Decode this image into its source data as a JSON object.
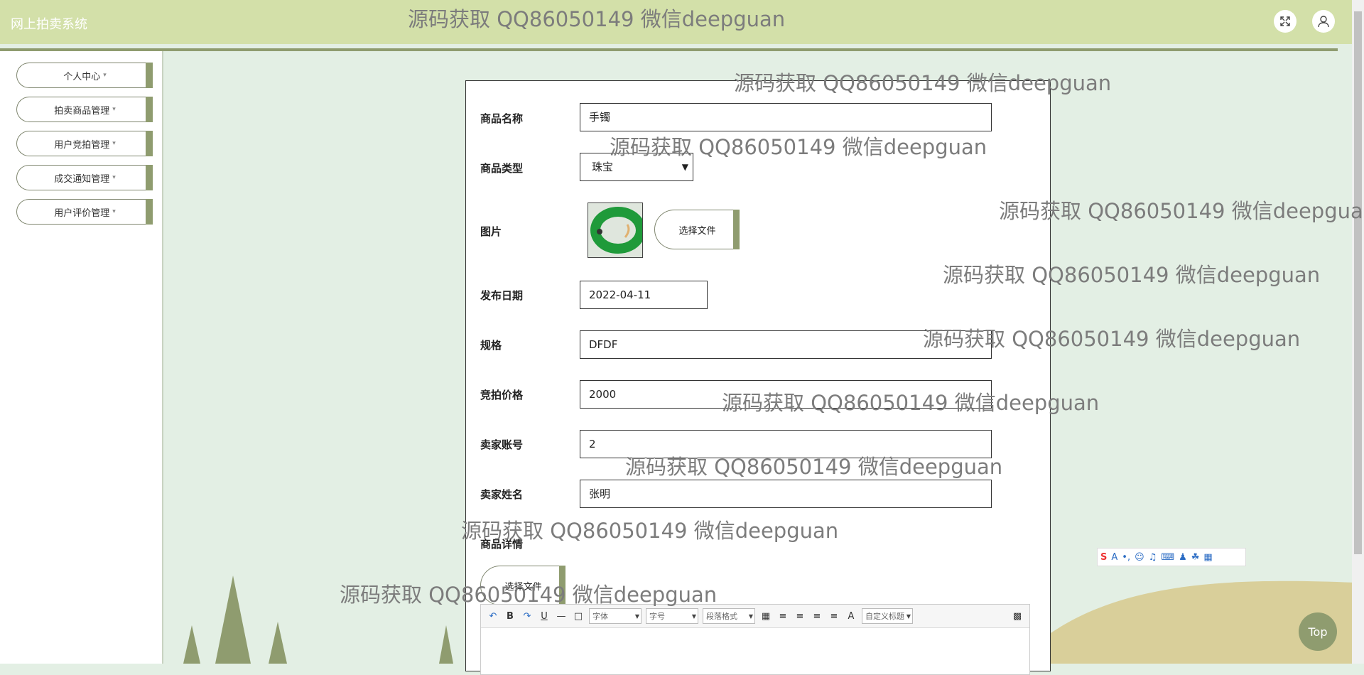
{
  "app": {
    "title": "网上拍卖系统"
  },
  "header": {
    "fullscreen_icon": "expand-icon",
    "user_icon": "user-icon"
  },
  "sidebar": {
    "items": [
      {
        "label": "个人中心"
      },
      {
        "label": "拍卖商品管理"
      },
      {
        "label": "用户竞拍管理"
      },
      {
        "label": "成交通知管理"
      },
      {
        "label": "用户评价管理"
      }
    ],
    "caret": "▾"
  },
  "form": {
    "name_label": "商品名称",
    "name_value": "手镯",
    "type_label": "商品类型",
    "type_value": "珠宝",
    "image_label": "图片",
    "choose_file": "选择文件",
    "date_label": "发布日期",
    "date_value": "2022-04-11",
    "spec_label": "规格",
    "spec_value": "DFDF",
    "price_label": "竞拍价格",
    "price_value": "2000",
    "seller_account_label": "卖家账号",
    "seller_account_value": "2",
    "seller_name_label": "卖家姓名",
    "seller_name_value": "张明",
    "detail_label": "商品详情",
    "detail_choose_file": "选择文件"
  },
  "editor": {
    "font_family": "字体",
    "font_size": "字号",
    "paragraph": "段落格式",
    "custom_title": "自定义标题"
  },
  "watermark": "源码获取 QQ86050149 微信deepguan",
  "top_button": "Top",
  "colors": {
    "accent": "#8f9c6f",
    "header": "#d3e0a9",
    "background": "#e3efe4"
  }
}
